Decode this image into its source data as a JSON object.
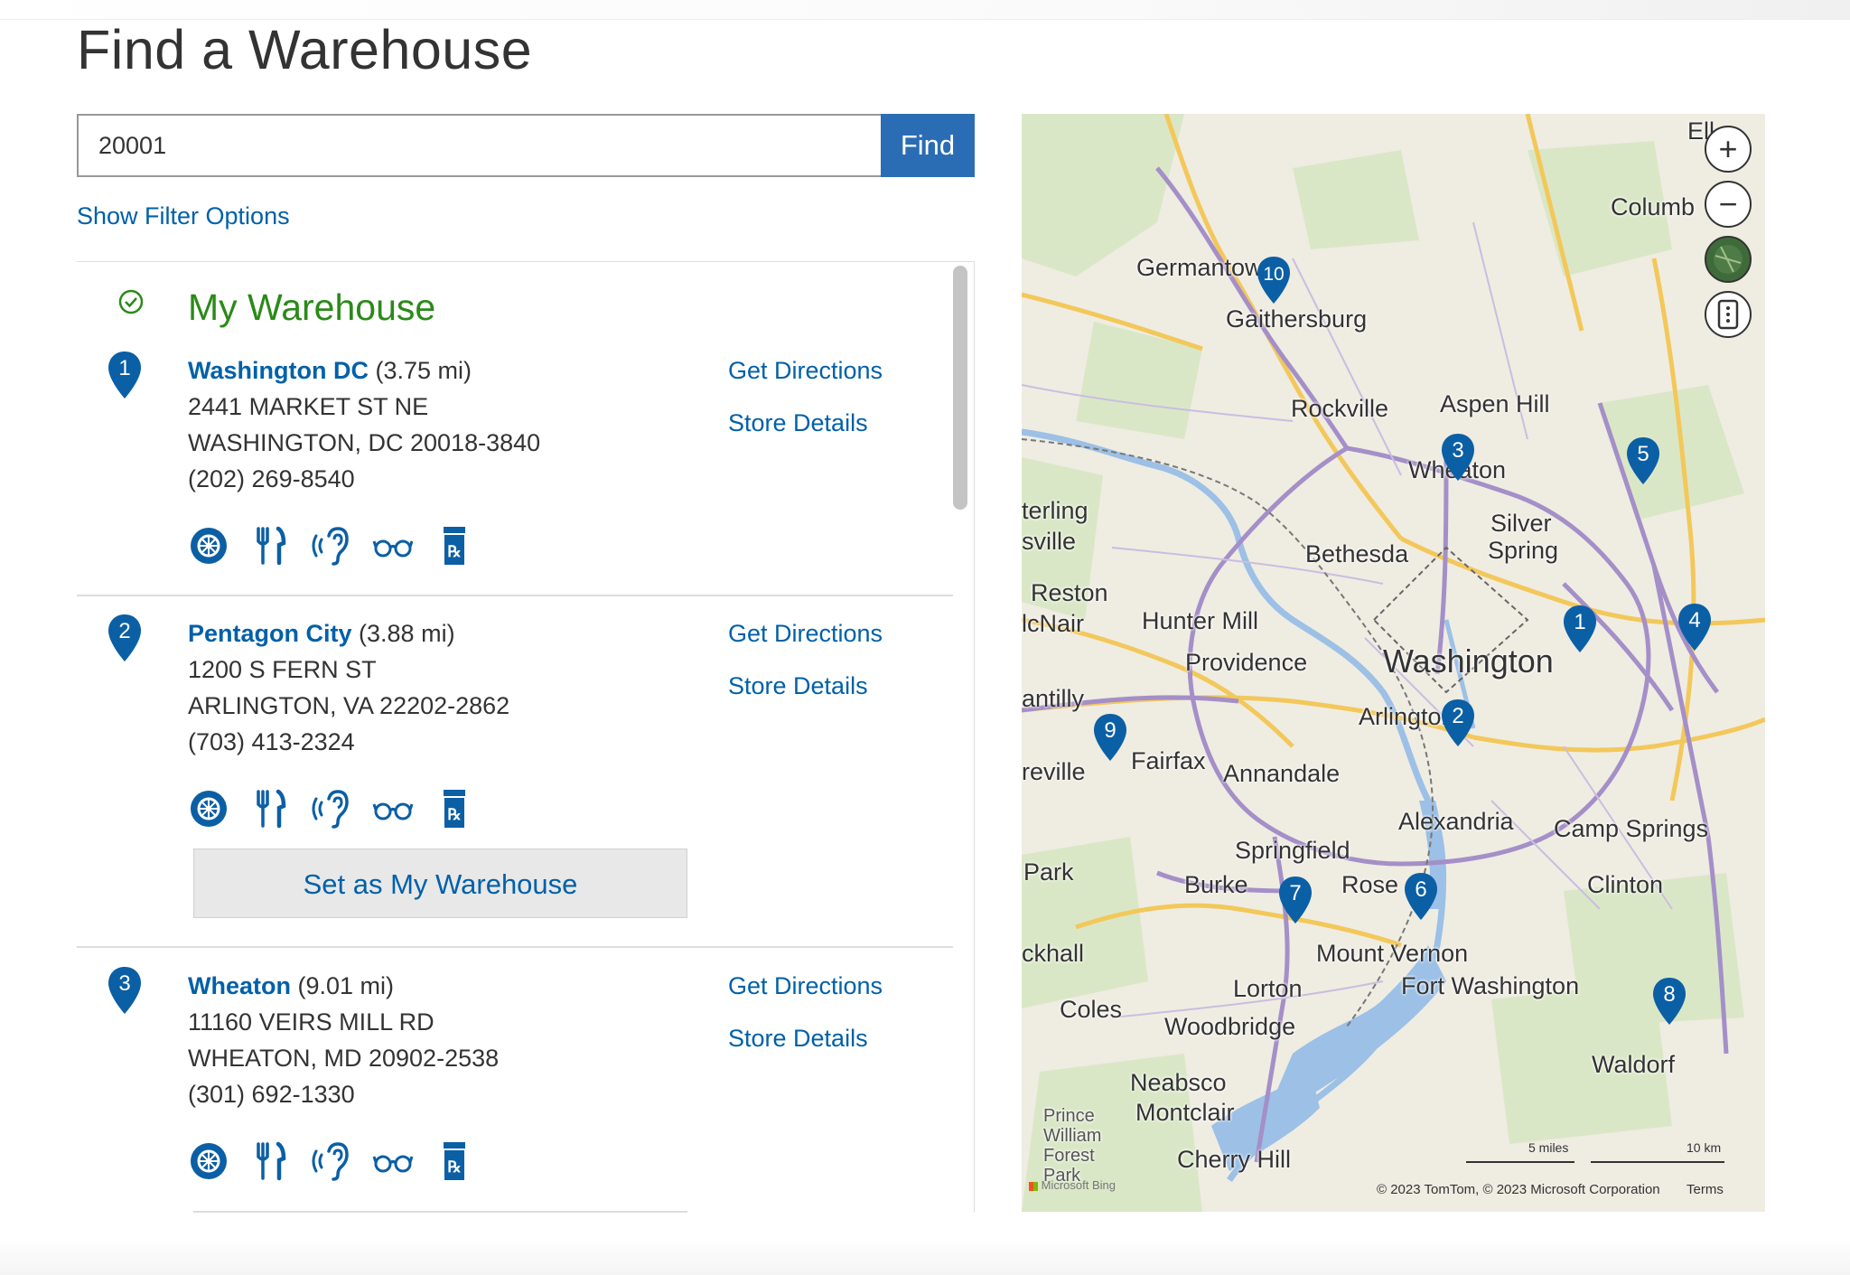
{
  "page": {
    "title": "Find a Warehouse"
  },
  "search": {
    "value": "20001",
    "button_label": "Find"
  },
  "filter_link": "Show Filter Options",
  "my_warehouse_label": "My Warehouse",
  "warehouses": [
    {
      "pin": "1",
      "name": "Washington DC",
      "distance": "(3.75 mi)",
      "street": "2441 MARKET ST NE",
      "city": "WASHINGTON, DC 20018-3840",
      "phone": "(202) 269-8540",
      "directions": "Get Directions",
      "details": "Store Details"
    },
    {
      "pin": "2",
      "name": "Pentagon City",
      "distance": "(3.88 mi)",
      "street": "1200 S FERN ST",
      "city": "ARLINGTON, VA 22202-2862",
      "phone": "(703) 413-2324",
      "directions": "Get Directions",
      "details": "Store Details",
      "set_button": "Set as My Warehouse"
    },
    {
      "pin": "3",
      "name": "Wheaton",
      "distance": "(9.01 mi)",
      "street": "11160 VEIRS MILL RD",
      "city": "WHEATON, MD 20902-2538",
      "phone": "(301) 692-1330",
      "directions": "Get Directions",
      "details": "Store Details"
    }
  ],
  "service_icons": [
    "tire-icon",
    "food-icon",
    "hearing-icon",
    "optical-icon",
    "pharmacy-icon"
  ],
  "colors": {
    "brand_blue": "#0060a9",
    "button_blue": "#2a6db5",
    "my_warehouse_green": "#2a8a18"
  },
  "map": {
    "labels": {
      "germantown": "Germantown",
      "gaithersburg": "Gaithersburg",
      "rockville": "Rockville",
      "aspen_hill": "Aspen Hill",
      "wheaton": "Wheaton",
      "silver": "Silver",
      "spring": "Spring",
      "bethesda": "Bethesda",
      "sterling": "terling",
      "sville": "sville",
      "reston": "Reston",
      "mcnair": "lcNair",
      "hunter_mill": "Hunter Mill",
      "providence": "Providence",
      "washington": "Washington",
      "arlington": "Arlington",
      "fairfax": "Fairfax",
      "annandale": "Annandale",
      "alexandria": "Alexandria",
      "camp_springs": "Camp Springs",
      "springfield": "Springfield",
      "burke": "Burke",
      "rose": "Rose",
      "clinton": "Clinton",
      "park": "Park",
      "ckhall": "ckhall",
      "mount_vernon": "Mount Vernon",
      "fort_washington": "Fort Washington",
      "lorton": "Lorton",
      "coles": "Coles",
      "woodbridge": "Woodbridge",
      "waldorf": "Waldorf",
      "neabsco": "Neabsco",
      "montclair": "Montclair",
      "cherry_hill": "Cherry Hill",
      "prince_william": "Prince William Forest Park",
      "columbia": "Columb",
      "ellicott": "Ell",
      "chantilly": "antilly",
      "centreville": "reville"
    },
    "pins": [
      "1",
      "2",
      "3",
      "4",
      "5",
      "6",
      "7",
      "8",
      "9",
      "10"
    ],
    "scale_miles": "5 miles",
    "scale_km": "10 km",
    "attribution": "© 2023 TomTom, © 2023 Microsoft Corporation",
    "terms": "Terms",
    "provider": "Microsoft Bing",
    "controls": {
      "zoom_in": "+",
      "zoom_out": "−"
    }
  }
}
